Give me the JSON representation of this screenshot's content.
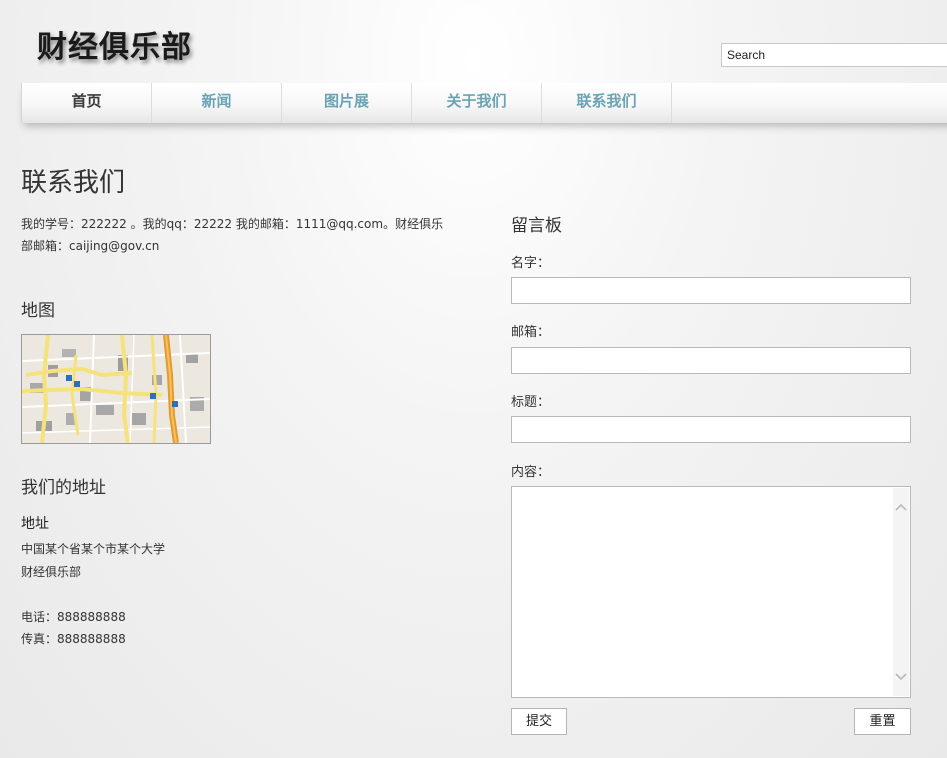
{
  "header": {
    "logo": "财经俱乐部",
    "search_placeholder": "Search"
  },
  "nav": {
    "items": [
      {
        "label": "首页",
        "active": true
      },
      {
        "label": "新闻",
        "active": false
      },
      {
        "label": "图片展",
        "active": false
      },
      {
        "label": "关于我们",
        "active": false
      },
      {
        "label": "联系我们",
        "active": false
      }
    ]
  },
  "main": {
    "title": "联系我们",
    "intro": "我的学号：222222 。我的qq：22222 我的邮箱：1111@qq.com。财经俱乐部邮箱：caijing@gov.cn",
    "map_heading": "地图",
    "address_heading": "我们的地址",
    "address_label": "地址",
    "address_line1": "中国某个省某个市某个大学",
    "address_line2": "财经俱乐部",
    "phone": "电话：888888888",
    "fax": "传真：888888888"
  },
  "form": {
    "heading": "留言板",
    "name_label": "名字：",
    "email_label": "邮箱：",
    "subject_label": "标题：",
    "content_label": "内容：",
    "submit_label": "提交",
    "reset_label": "重置"
  },
  "colors": {
    "nav_link": "#6aa4b4",
    "nav_active": "#3a3a3a"
  }
}
